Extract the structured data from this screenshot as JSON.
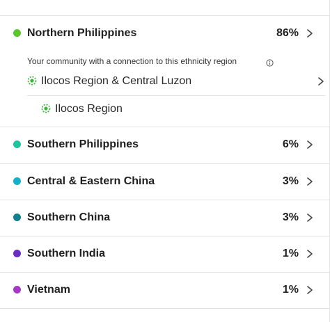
{
  "regions": [
    {
      "name": "Northern Philippines",
      "percent": "86%",
      "color": "#5cc62f"
    },
    {
      "name": "Southern Philippines",
      "percent": "6%",
      "color": "#1fc3a0"
    },
    {
      "name": "Central & Eastern China",
      "percent": "3%",
      "color": "#14b0c9"
    },
    {
      "name": "Southern China",
      "percent": "3%",
      "color": "#137f8f"
    },
    {
      "name": "Southern India",
      "percent": "1%",
      "color": "#6a2ec0"
    },
    {
      "name": "Vietnam",
      "percent": "1%",
      "color": "#a638c8"
    }
  ],
  "community": {
    "note": "Your community with a connection to this ethnicity region",
    "info_icon": "info-icon",
    "icon": "community-dot-icon",
    "icon_color": "#3cb43c",
    "primary": "Ilocos Region & Central Luzon",
    "secondary": "Ilocos Region"
  },
  "icons": {
    "chevron": "chevron-right-icon"
  }
}
